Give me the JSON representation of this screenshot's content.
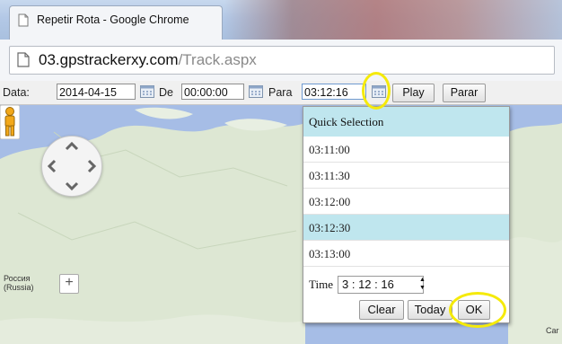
{
  "window": {
    "title": "Repetir Rota - Google Chrome"
  },
  "address": {
    "host": "03.gpstrackerxy.com",
    "path": "/Track.aspx"
  },
  "toolbar": {
    "data_label": "Data:",
    "date_value": "2014-04-15",
    "de_label": "De",
    "from_value": "00:00:00",
    "para_label": "Para",
    "to_value": "03:12:16",
    "play_label": "Play",
    "stop_label": "Parar"
  },
  "picker": {
    "header": "Quick Selection",
    "options": [
      "03:11:00",
      "03:11:30",
      "03:12:00",
      "03:12:30",
      "03:13:00"
    ],
    "selected_index": 3,
    "time_label": "Time",
    "time_value": "3 : 12 : 16",
    "clear_label": "Clear",
    "today_label": "Today",
    "ok_label": "OK"
  },
  "map": {
    "label_russia": "Россия\n(Russia)",
    "label_russia_line1": "Россия",
    "label_russia_line2": "(Russia)",
    "label_right": "Car",
    "zoom_in": "+"
  },
  "colors": {
    "highlight": "#f5ea0a",
    "selection": "#bfe6ee",
    "water": "#a6bde6",
    "land": "#dde7d3"
  },
  "icons": [
    "page-icon",
    "calendar-icon",
    "pegman-icon",
    "pan-control-icon",
    "zoom-in-icon",
    "spinner-up-icon",
    "spinner-down-icon"
  ]
}
